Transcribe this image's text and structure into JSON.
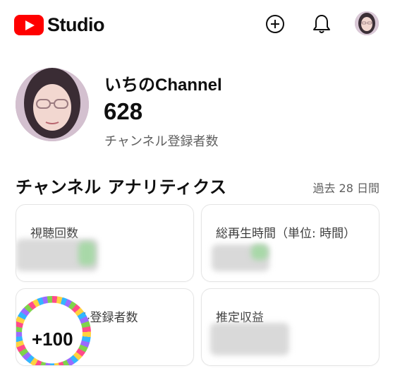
{
  "app": {
    "logo_text": "Studio",
    "colors": {
      "brand": "#ff0000",
      "text": "#0f0f0f",
      "secondary": "#606060"
    }
  },
  "header": {
    "icons": [
      "create-icon",
      "notifications-icon",
      "account-avatar"
    ]
  },
  "channel": {
    "name": "いちのChannel",
    "subscriber_count": "628",
    "subscriber_label": "チャンネル登録者数"
  },
  "analytics": {
    "title": "チャンネル アナリティクス",
    "period": "過去 28 日間",
    "cards": [
      {
        "label": "視聴回数",
        "value": ""
      },
      {
        "label": "総再生時間（単位: 時間）",
        "value": ""
      },
      {
        "label": "チャンネル登録者数",
        "value": "+100"
      },
      {
        "label": "推定収益",
        "value": ""
      }
    ]
  }
}
